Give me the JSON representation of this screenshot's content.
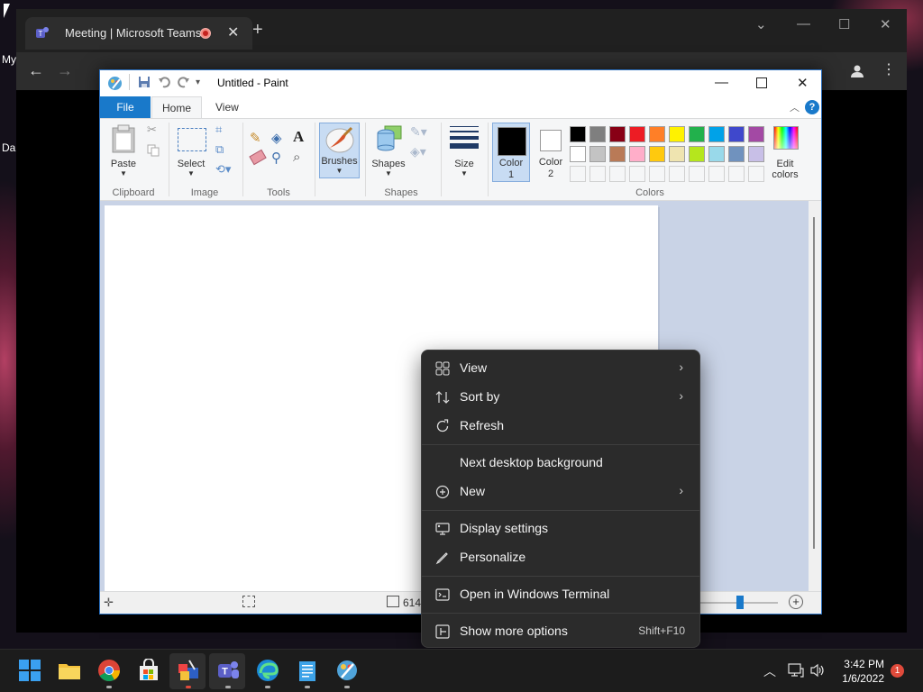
{
  "desktop": {
    "labels": [
      "My",
      "Da"
    ]
  },
  "browser": {
    "tab_title": "Meeting | Microsoft Teams",
    "tab_close": "✕",
    "new_tab": "+",
    "controls": {
      "dropdown": "⌄",
      "minimize": "—",
      "maximize": "☐",
      "close": "✕"
    },
    "nav": {
      "back": "←",
      "forward": "→",
      "more": "⋮"
    }
  },
  "paint": {
    "title": "Untitled - Paint",
    "tabs": {
      "file": "File",
      "home": "Home",
      "view": "View"
    },
    "ribbon": {
      "paste": "Paste",
      "select": "Select",
      "brushes": "Brushes",
      "shapes": "Shapes",
      "size": "Size",
      "color1_a": "Color",
      "color1_b": "1",
      "color2_a": "Color",
      "color2_b": "2",
      "edit_colors_a": "Edit",
      "edit_colors_b": "colors",
      "groups": {
        "clipboard": "Clipboard",
        "image": "Image",
        "tools": "Tools",
        "shapes": "Shapes",
        "colors": "Colors"
      }
    },
    "palette_row1": [
      "#000000",
      "#7f7f7f",
      "#880015",
      "#ed1c24",
      "#ff7f27",
      "#fff200",
      "#22b14c",
      "#00a2e8",
      "#3f48cc",
      "#a349a4"
    ],
    "palette_row2": [
      "#ffffff",
      "#c3c3c3",
      "#b97a57",
      "#ffaec9",
      "#ffc90e",
      "#efe4b0",
      "#b5e61d",
      "#99d9ea",
      "#7092be",
      "#c8bfe7"
    ],
    "status": {
      "size_value": "614"
    }
  },
  "context_menu": {
    "items": [
      {
        "label": "View",
        "icon": "view-grid-icon",
        "submenu": true
      },
      {
        "label": "Sort by",
        "icon": "sort-icon",
        "submenu": true
      },
      {
        "label": "Refresh",
        "icon": "refresh-icon",
        "submenu": false
      },
      {
        "label": "Next desktop background",
        "icon": "",
        "submenu": false
      },
      {
        "label": "New",
        "icon": "new-plus-icon",
        "submenu": true
      },
      {
        "label": "Display settings",
        "icon": "display-icon",
        "submenu": false
      },
      {
        "label": "Personalize",
        "icon": "brush-icon",
        "submenu": false
      },
      {
        "label": "Open in Windows Terminal",
        "icon": "terminal-icon",
        "submenu": false
      },
      {
        "label": "Show more options",
        "icon": "more-options-icon",
        "submenu": false
      }
    ],
    "shortcut": "Shift+F10",
    "chevron": "›"
  },
  "taskbar": {
    "time": "3:42 PM",
    "date": "1/6/2022",
    "notification_count": "1"
  }
}
